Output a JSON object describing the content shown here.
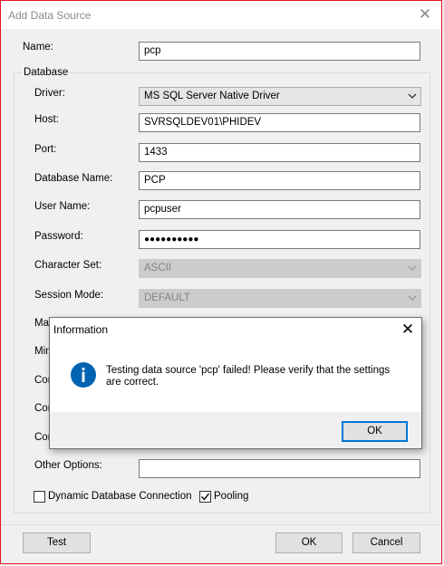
{
  "window": {
    "title": "Add Data Source"
  },
  "fields": {
    "name_label": "Name:",
    "name_value": "pcp",
    "group_label": "Database",
    "driver_label": "Driver:",
    "driver_value": "MS SQL Server Native Driver",
    "host_label": "Host:",
    "host_value": "SVRSQLDEV01\\PHIDEV",
    "port_label": "Port:",
    "port_value": "1433",
    "dbname_label": "Database Name:",
    "dbname_value": "PCP",
    "user_label": "User Name:",
    "user_value": "pcpuser",
    "password_label": "Password:",
    "password_value": "●●●●●●●●●●",
    "charset_label": "Character Set:",
    "charset_value": "ASCII",
    "session_label": "Session Mode:",
    "session_value": "DEFAULT",
    "max_label_partial": "Ma",
    "min_label_partial": "Mini",
    "con1_label_partial": "Con",
    "con2_label_partial": "Con",
    "con3_label_partial": "Con",
    "other_label": "Other Options:",
    "other_value": ""
  },
  "checkboxes": {
    "dynamic_label": "Dynamic Database Connection",
    "dynamic_checked": false,
    "pooling_label": "Pooling",
    "pooling_checked": true
  },
  "buttons": {
    "test": "Test",
    "ok": "OK",
    "cancel": "Cancel"
  },
  "dialog": {
    "title": "Information",
    "message": "Testing data source 'pcp' failed! Please verify that the settings are correct.",
    "icon_letter": "i",
    "ok": "OK"
  },
  "colors": {
    "accent": "#0078d7",
    "window_border": "#e81123",
    "info_icon": "#0063b1"
  }
}
